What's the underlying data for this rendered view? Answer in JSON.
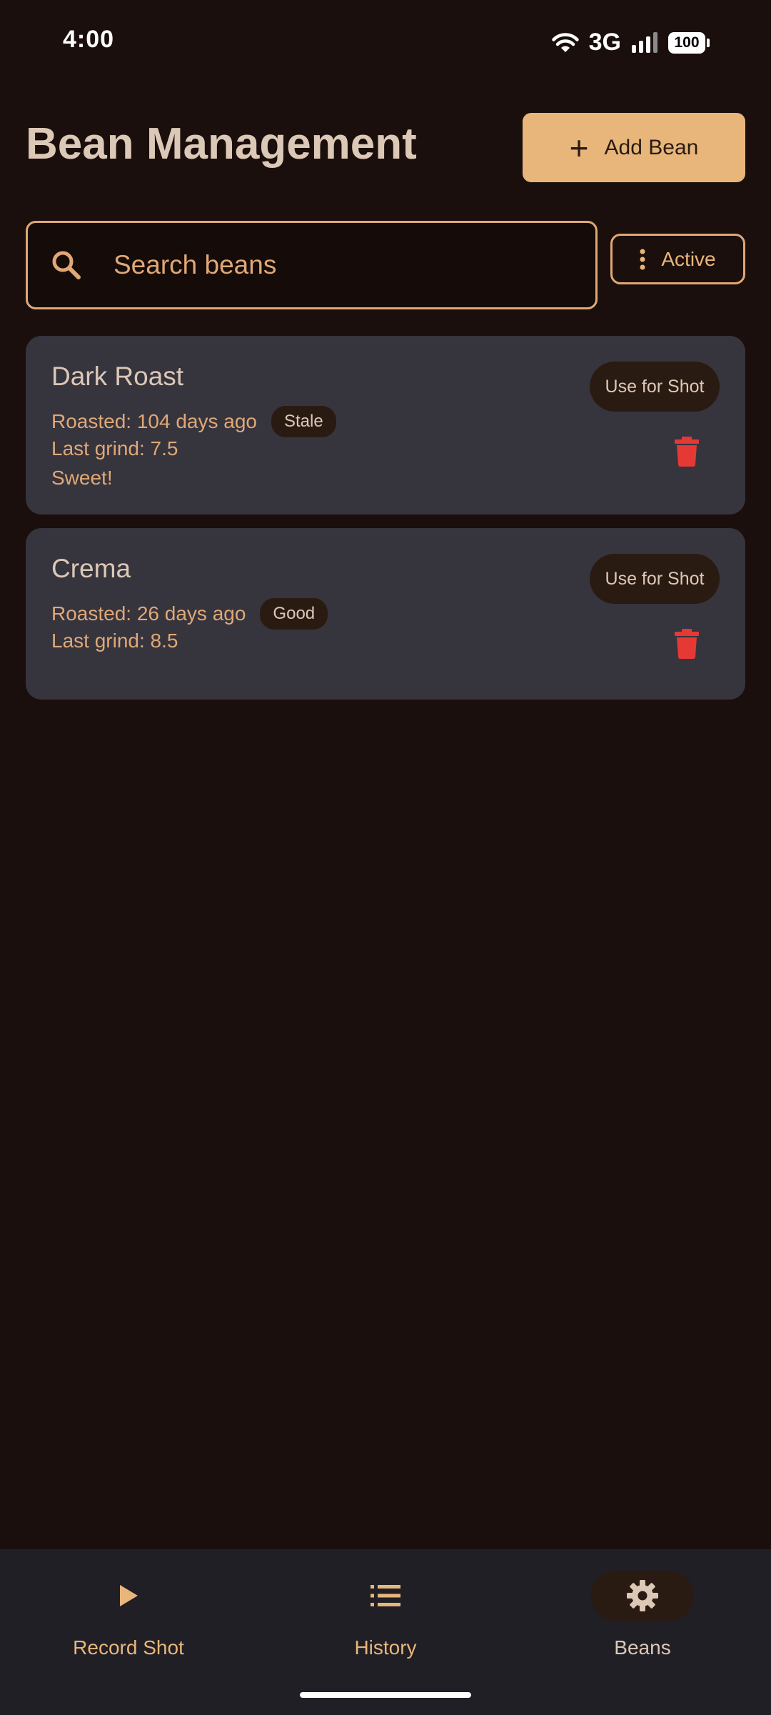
{
  "status_bar": {
    "time": "4:00",
    "network": "3G",
    "battery": "100"
  },
  "header": {
    "title": "Bean Management",
    "add_button_label": "Add Bean"
  },
  "search": {
    "placeholder": "Search beans",
    "value": ""
  },
  "filter": {
    "label": "Active"
  },
  "beans": [
    {
      "name": "Dark Roast",
      "roasted": "Roasted: 104 days ago",
      "freshness": "Stale",
      "last_grind": "Last grind: 7.5",
      "notes": "Sweet!",
      "use_label": "Use for Shot"
    },
    {
      "name": "Crema",
      "roasted": "Roasted: 26 days ago",
      "freshness": "Good",
      "last_grind": "Last grind: 8.5",
      "notes": "",
      "use_label": "Use for Shot"
    }
  ],
  "bottom_nav": {
    "items": [
      {
        "label": "Record Shot",
        "icon": "play-icon",
        "active": false
      },
      {
        "label": "History",
        "icon": "list-icon",
        "active": false
      },
      {
        "label": "Beans",
        "icon": "gear-icon",
        "active": true
      }
    ]
  },
  "colors": {
    "background": "#1a0f0c",
    "accent": "#e8b67b",
    "card": "#36343d",
    "delete": "#e53935"
  }
}
